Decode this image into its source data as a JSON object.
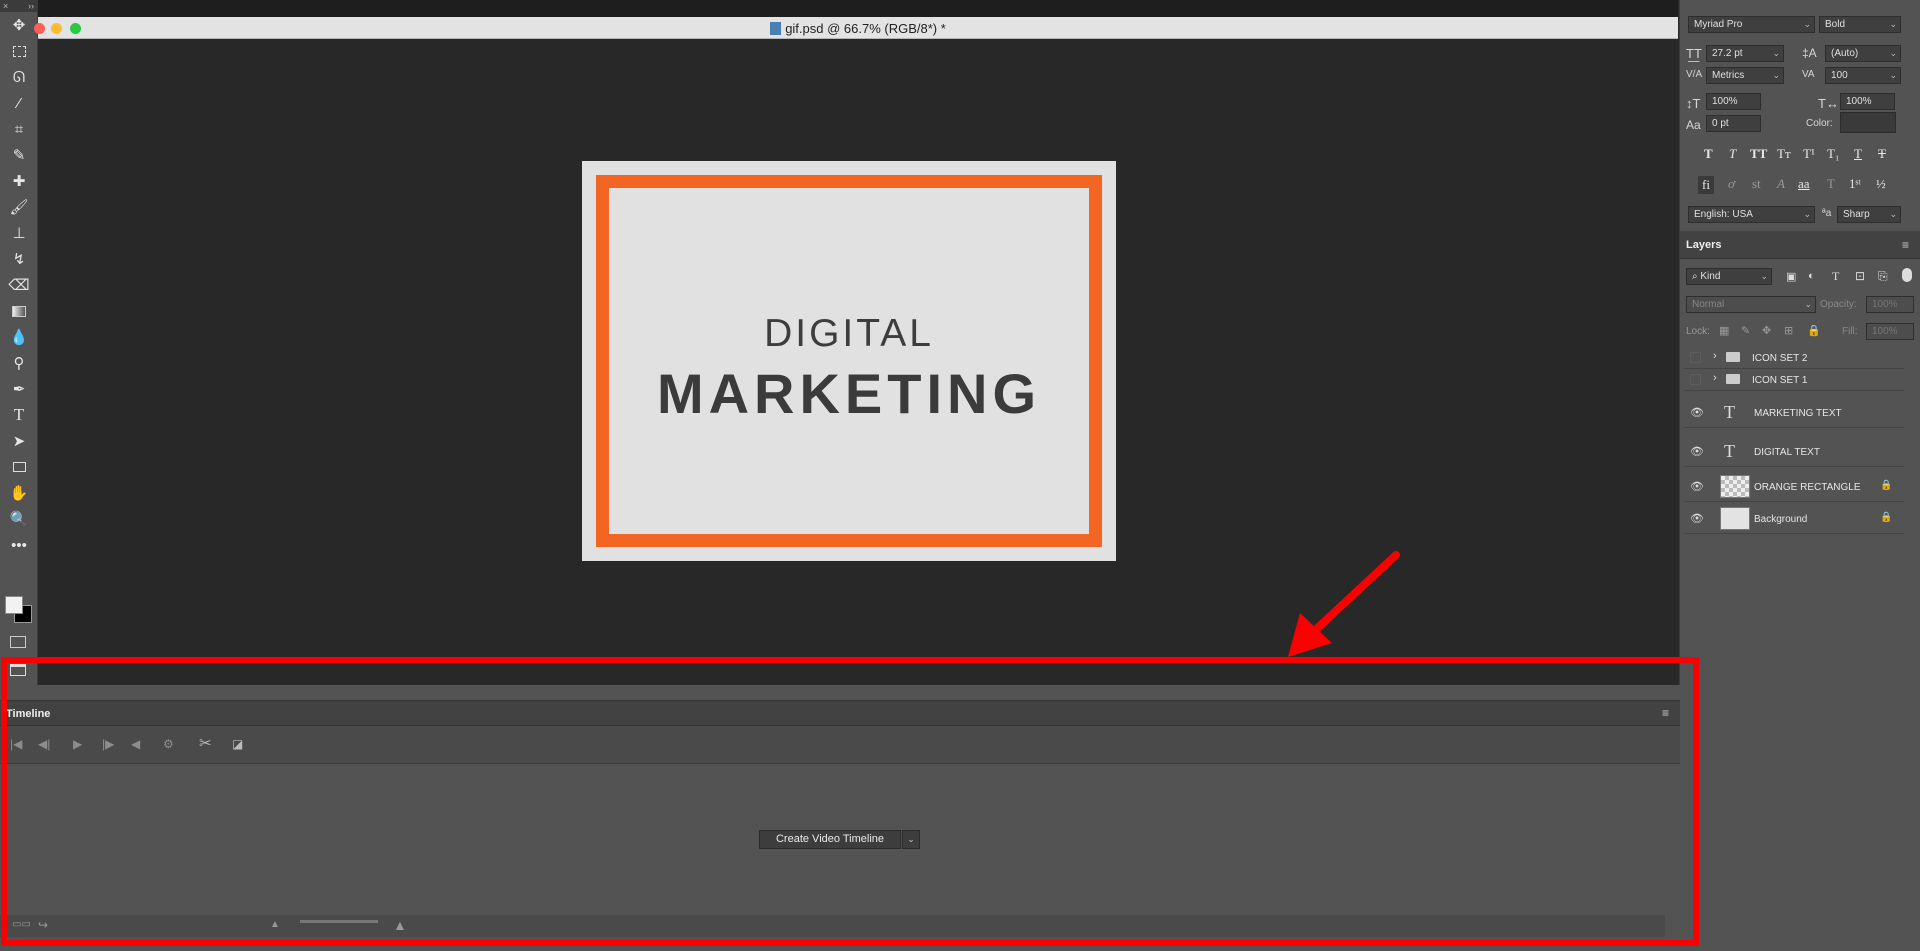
{
  "document": {
    "title": "gif.psd @ 66.7% (RGB/8*) *"
  },
  "artwork": {
    "line1": "DIGITAL",
    "line2": "MARKETING",
    "frame_color": "#f26522",
    "background_color": "#e1e1e1"
  },
  "toolbar": {
    "collapse": "×",
    "expand": "››",
    "tools": [
      "move-icon",
      "marquee-icon",
      "lasso-icon",
      "magic-wand-icon",
      "crop-icon",
      "eyedropper-icon",
      "healing-icon",
      "brush-icon",
      "stamp-icon",
      "history-brush-icon",
      "eraser-icon",
      "gradient-icon",
      "blur-icon",
      "dodge-icon",
      "pen-icon",
      "type-icon",
      "path-select-icon",
      "rectangle-icon",
      "hand-icon",
      "zoom-icon",
      "more-icon"
    ]
  },
  "character": {
    "font_family": "Myriad Pro",
    "font_style": "Bold",
    "font_size": "27.2 pt",
    "leading": "(Auto)",
    "kerning": "Metrics",
    "tracking": "100",
    "vertical_scale": "100%",
    "horizontal_scale": "100%",
    "baseline_shift": "0 pt",
    "color_label": "Color:",
    "language": "English: USA",
    "antialias_label": "ªa",
    "antialias": "Sharp"
  },
  "layers": {
    "tab": "Layers",
    "filter": "Kind",
    "blend_mode": "Normal",
    "opacity_label": "Opacity:",
    "opacity": "100%",
    "lock_label": "Lock:",
    "fill_label": "Fill:",
    "fill": "100%",
    "items": [
      {
        "name": "ICON SET 2",
        "type": "group",
        "visible": false
      },
      {
        "name": "ICON SET 1",
        "type": "group",
        "visible": false
      },
      {
        "name": "MARKETING TEXT",
        "type": "text",
        "visible": true
      },
      {
        "name": "DIGITAL TEXT",
        "type": "text",
        "visible": true
      },
      {
        "name": "ORANGE RECTANGLE",
        "type": "shape",
        "visible": true,
        "locked": true
      },
      {
        "name": "Background",
        "type": "background",
        "visible": true,
        "locked": true
      }
    ]
  },
  "timeline": {
    "tab": "Timeline",
    "create_button": "Create Video Timeline"
  },
  "annotation": {
    "color": "#fa0000"
  }
}
